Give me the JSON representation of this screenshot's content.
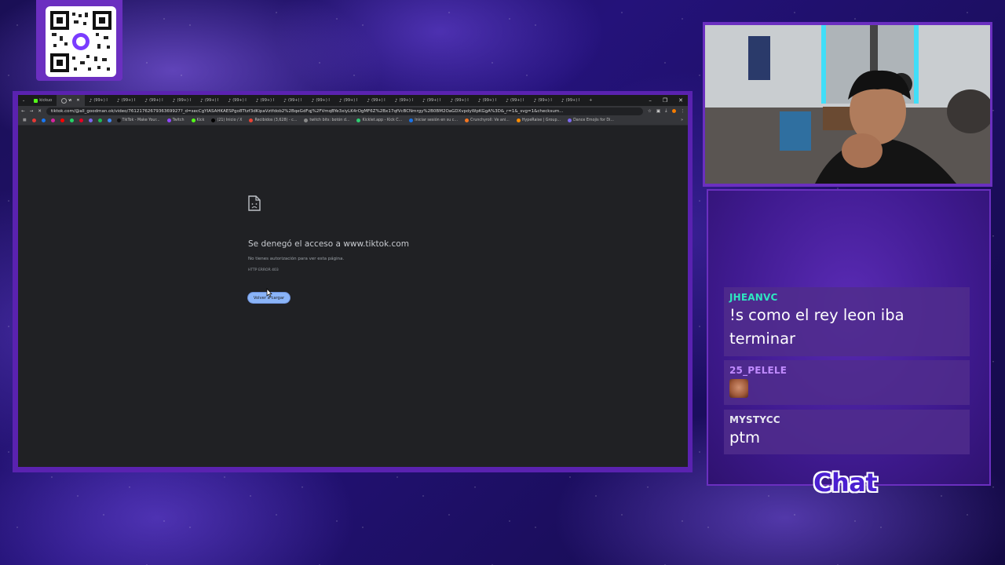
{
  "browser": {
    "tabs": [
      {
        "label": "kickuo",
        "icon": "kick-icon",
        "active": false
      },
      {
        "label": "w",
        "icon": "loading-icon",
        "active": true
      },
      {
        "label": "(99+) I",
        "icon": "tiktok-icon"
      },
      {
        "label": "(99+) I",
        "icon": "tiktok-icon"
      },
      {
        "label": "(99+) I",
        "icon": "tiktok-icon"
      },
      {
        "label": "(99+) I",
        "icon": "tiktok-icon"
      },
      {
        "label": "(99+) I",
        "icon": "tiktok-icon"
      },
      {
        "label": "(99+) I",
        "icon": "tiktok-icon"
      },
      {
        "label": "(99+) I",
        "icon": "tiktok-icon"
      },
      {
        "label": "(99+) I",
        "icon": "tiktok-icon"
      },
      {
        "label": "(99+) I",
        "icon": "tiktok-icon"
      },
      {
        "label": "(99+) I",
        "icon": "tiktok-icon"
      },
      {
        "label": "(99+) I",
        "icon": "tiktok-icon"
      },
      {
        "label": "(99+) I",
        "icon": "tiktok-icon"
      },
      {
        "label": "(99+) I",
        "icon": "tiktok-icon"
      },
      {
        "label": "(99+) I",
        "icon": "tiktok-icon"
      },
      {
        "label": "(99+) I",
        "icon": "tiktok-icon"
      },
      {
        "label": "(99+) I",
        "icon": "tiktok-icon"
      },
      {
        "label": "(99+) I",
        "icon": "tiktok-icon"
      },
      {
        "label": "(99+) I",
        "icon": "tiktok-icon"
      }
    ],
    "new_tab": "+",
    "url": "tiktok.com/@all_goodman.ok/video/7612176267936369927?_d=secCgYIASAHKAESPgo8Ttzf3dKipaVztfdob2%2BqeGdFqj%2FVmqBYe3xiyLK4rOgMF6Z%2Bx17qfVcBCNmrgy%2B0BM2OaGDXvpdyWpKGgA%3D&_r=1&_svg=1&checksum...",
    "bookmarks": [
      "TikTok - Make Your...",
      "Twitch",
      "Kick",
      "(21) Inicio / X",
      "Recibidos (3,628) - c...",
      "twitch bits: botón d...",
      "Kicklet.app - Kick C...",
      "Iniciar sesión en su c...",
      "Crunchyroll: Ve ani...",
      "HypeRaise | Group...",
      "Dance Emojis for Di..."
    ],
    "error": {
      "title": "Se denegó el acceso a www.tiktok.com",
      "description": "No tienes autorización para ver esta página.",
      "code": "HTTP ERROR 403",
      "reload_label": "Volver a cargar"
    }
  },
  "chat": {
    "title": "Chat",
    "messages": [
      {
        "user": "JHEANVC",
        "user_color": "#2ee6c0",
        "text": "!s como el rey leon iba terminar"
      },
      {
        "user": "25_PELELE",
        "user_color": "#c08bff",
        "text": "",
        "emote": "face-emote"
      },
      {
        "user": "MYSTYCC",
        "user_color": "#e8e8f0",
        "text": "ptm"
      }
    ]
  },
  "colors": {
    "frame": "#6b2fc0",
    "chrome_blue": "#8ab4f8"
  }
}
